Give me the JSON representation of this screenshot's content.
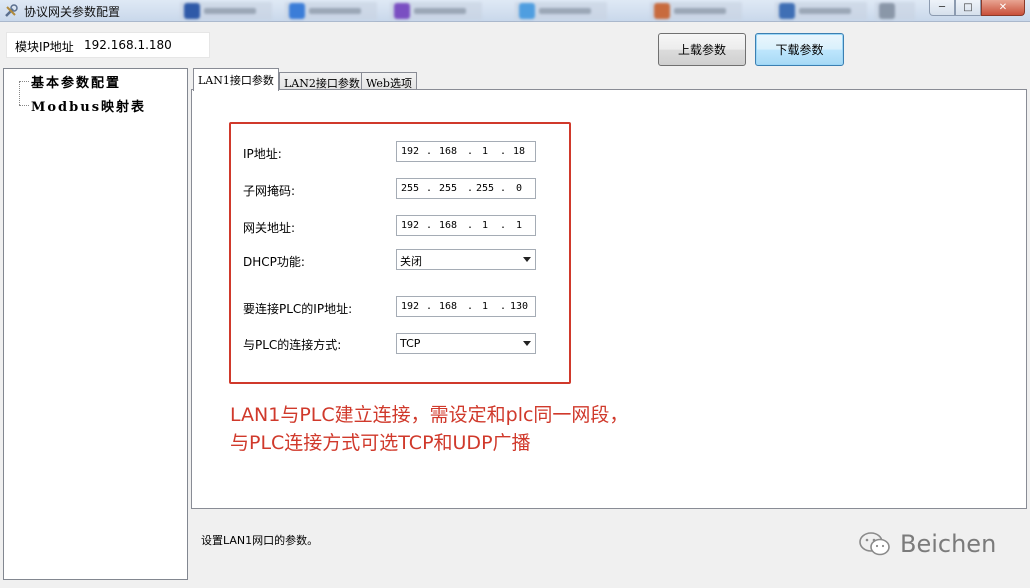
{
  "window": {
    "title": "协议网关参数配置",
    "icon": "tools-icon",
    "controls": [
      "─",
      "□",
      "✕"
    ]
  },
  "toolbar": {
    "ip_label": "模块IP地址",
    "ip_value": "192.168.1.180",
    "upload_label": "上载参数",
    "download_label": "下载参数"
  },
  "tree": {
    "items": [
      {
        "label": "基本参数配置"
      },
      {
        "label": "Modbus映射表"
      }
    ]
  },
  "tabs": [
    {
      "label": "LAN1接口参数",
      "active": true
    },
    {
      "label": "LAN2接口参数",
      "active": false
    },
    {
      "label": "Web选项",
      "active": false
    }
  ],
  "form": {
    "ip": {
      "label": "IP地址:",
      "octets": [
        "192",
        "168",
        "1",
        "18"
      ]
    },
    "subnet": {
      "label": "子网掩码:",
      "octets": [
        "255",
        "255",
        "255",
        "0"
      ]
    },
    "gateway": {
      "label": "网关地址:",
      "octets": [
        "192",
        "168",
        "1",
        "1"
      ]
    },
    "dhcp": {
      "label": "DHCP功能:",
      "value": "关闭"
    },
    "plc_ip": {
      "label": "要连接PLC的IP地址:",
      "octets": [
        "192",
        "168",
        "1",
        "130"
      ]
    },
    "plc_mode": {
      "label": "与PLC的连接方式:",
      "value": "TCP"
    }
  },
  "annotation": {
    "line1": "LAN1与PLC建立连接，需设定和plc同一网段，",
    "line2": "与PLC连接方式可选TCP和UDP广播",
    "color": "#d0392b"
  },
  "status": {
    "text": "设置LAN1网口的参数。"
  },
  "watermark": {
    "icon": "wechat-icon",
    "text": "Beichen"
  }
}
